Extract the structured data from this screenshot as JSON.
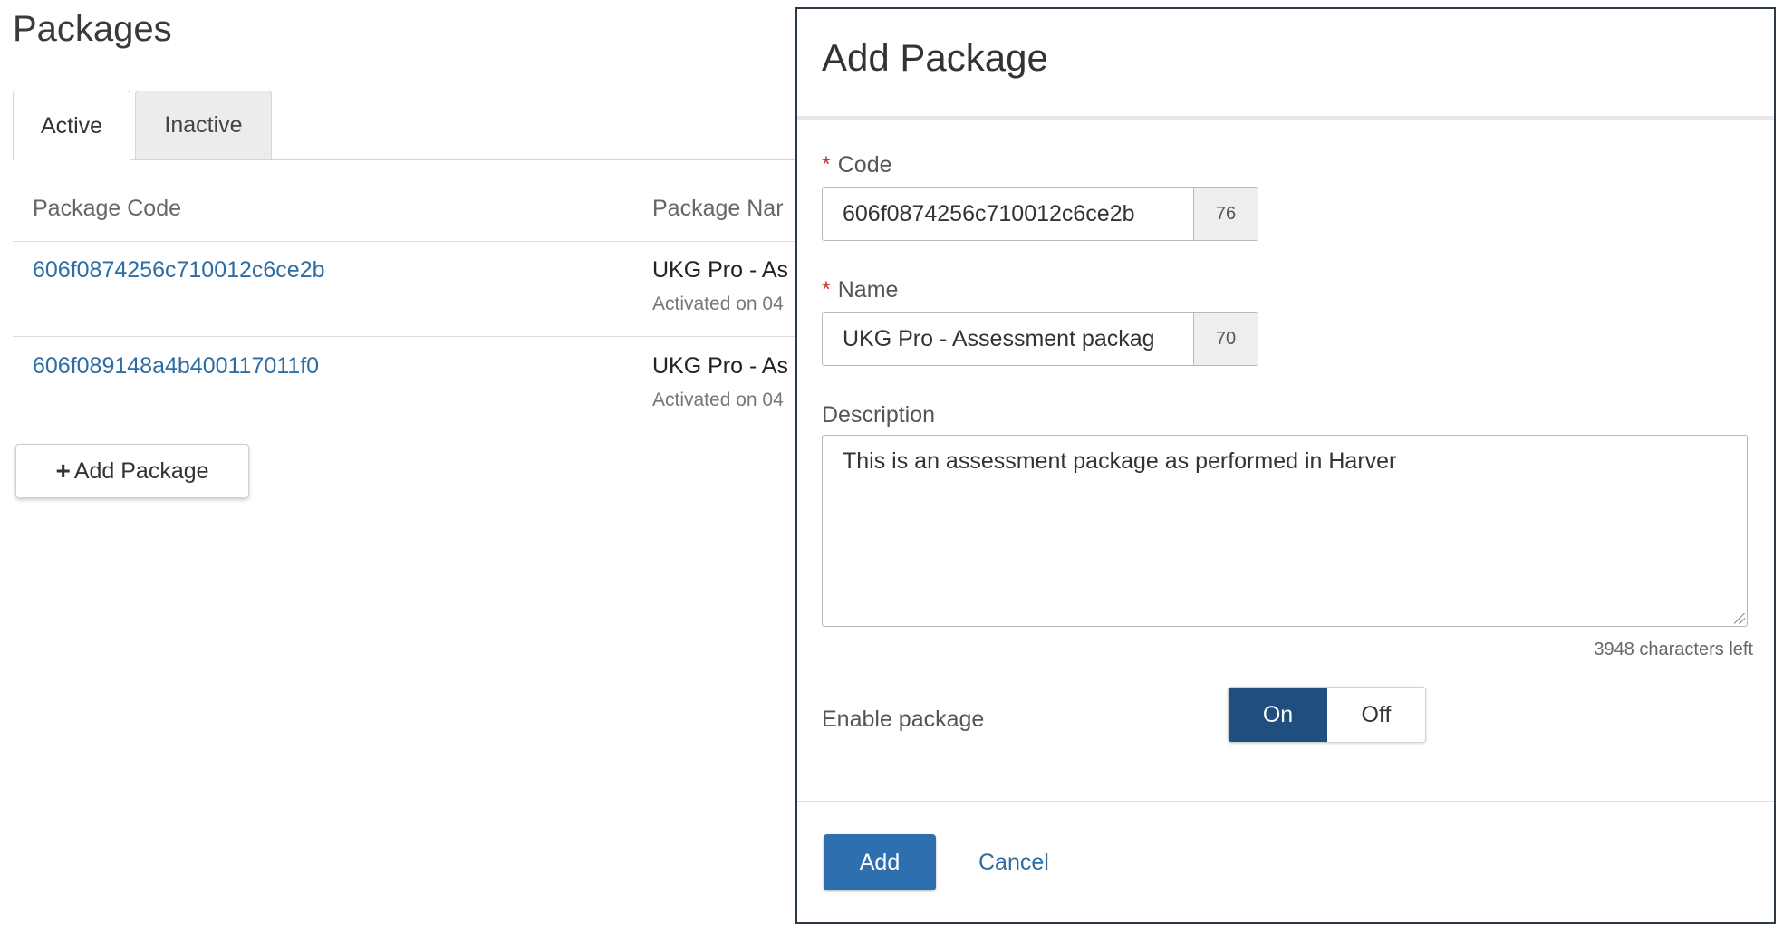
{
  "page": {
    "title": "Packages"
  },
  "tabs": [
    {
      "label": "Active",
      "selected": true
    },
    {
      "label": "Inactive",
      "selected": false
    }
  ],
  "table": {
    "columns": [
      "Package Code",
      "Package Nar"
    ],
    "rows": [
      {
        "code": "606f0874256c710012c6ce2b",
        "name": "UKG Pro - As",
        "sub": "Activated on 04"
      },
      {
        "code": "606f089148a4b400117011f0",
        "name": "UKG Pro - As",
        "sub": "Activated on 04"
      }
    ]
  },
  "add_package_button": {
    "label": "Add Package"
  },
  "modal": {
    "title": "Add Package",
    "code": {
      "label": "Code",
      "value": "606f0874256c710012c6ce2b",
      "count": "76"
    },
    "name": {
      "label": "Name",
      "value": "UKG Pro - Assessment packag",
      "count": "70"
    },
    "description": {
      "label": "Description",
      "value": "This is an assessment package as performed in Harver",
      "chars_left": "3948 characters left"
    },
    "enable": {
      "label": "Enable package",
      "on_label": "On",
      "off_label": "Off",
      "state": "On"
    },
    "add_label": "Add",
    "cancel_label": "Cancel"
  },
  "colors": {
    "accent": "#2e6fb0",
    "toggle_on": "#1f4e7f",
    "link": "#2e6da4",
    "required": "#c0392b"
  }
}
